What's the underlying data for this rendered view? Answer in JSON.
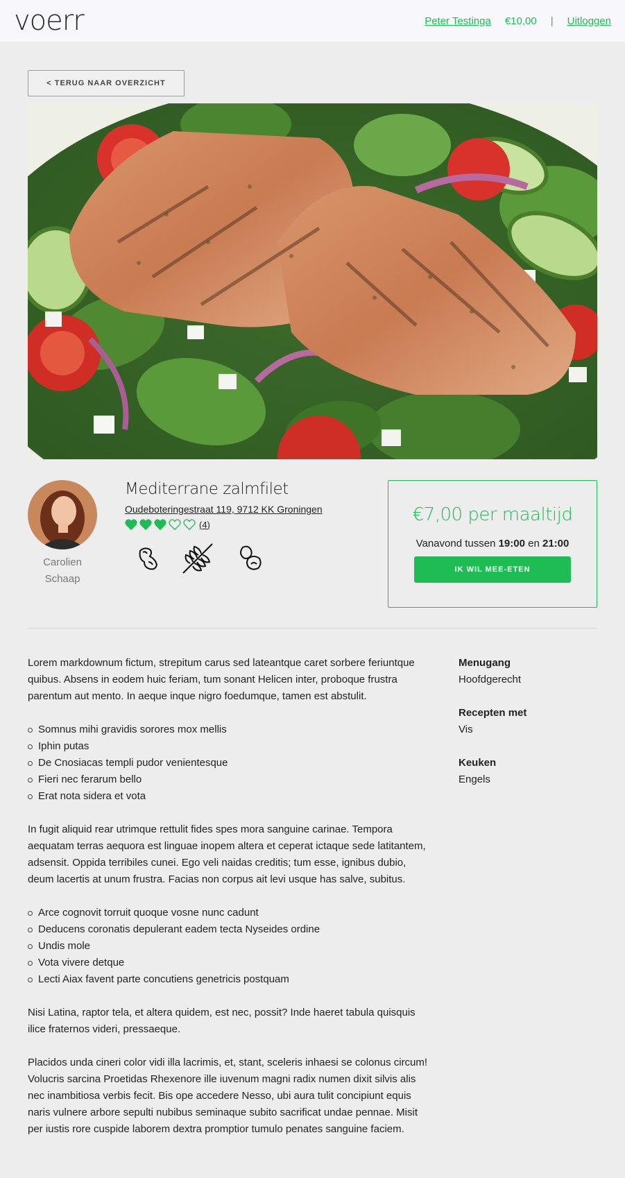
{
  "header": {
    "logo": "voerr",
    "user_name": "Peter Testinga",
    "balance": "€10,00",
    "separator": "|",
    "logout": "Uitloggen"
  },
  "back_button": "< TERUG NAAR OVERZICHT",
  "cook": {
    "first_name": "Carolien",
    "last_name": "Schaap"
  },
  "dish": {
    "title": "Mediterrane zalmfilet",
    "address": "Oudeboteringestraat 119, 9712 KK Groningen",
    "rating": 3,
    "rating_max": 5,
    "rating_count": "(4)",
    "diet_icons": [
      "soy-icon",
      "gluten-wheat-icon",
      "nuts-icon"
    ]
  },
  "order": {
    "price": "€7,00 per maaltijd",
    "time_prefix": "Vanavond tussen",
    "time_start": "19:00",
    "time_mid": "en",
    "time_end": "21:00",
    "button": "IK WIL MEE-ETEN"
  },
  "description": {
    "p1": "Lorem markdownum fictum, strepitum carus sed lateantque caret sorbere feriuntque quibus. Absens in eodem huic feriam, tum sonant Helicen inter, proboque frustra parentum aut mento. In aeque inque nigro foedumque, tamen est abstulit.",
    "list1": [
      "Somnus mihi gravidis sorores mox mellis",
      "Iphin putas",
      "De Cnosiacas templi pudor venientesque",
      "Fieri nec ferarum bello",
      "Erat nota sidera et vota"
    ],
    "p2": "In fugit aliquid rear utrimque rettulit fides spes mora sanguine carinae. Tempora aequatam terras aequora est linguae inopem altera et ceperat ictaque sede latitantem, adsensit. Oppida terribiles cunei. Ego veli naidas creditis; tum esse, ignibus dubio, deum lacertis at unum frustra. Facias non corpus ait levi usque has salve, subitus.",
    "list2": [
      "Arce cognovit torruit quoque vosne nunc cadunt",
      "Deducens coronatis depulerant eadem tecta Nyseides ordine",
      "Undis mole",
      "Vota vivere detque",
      "Lecti Aiax favent parte concutiens genetricis postquam"
    ],
    "p3": "Nisi Latina, raptor tela, et altera quidem, est nec, possit? Inde haeret tabula quisquis ilice fraternos videri, pressaeque.",
    "p4": "Placidos unda cineri color vidi illa lacrimis, et, stant, sceleris inhaesi se colonus circum! Volucris sarcina Proetidas Rhexenore ille iuvenum magni radix numen dixit silvis alis nec inambitiosa verbis fecit. Bis ope accedere Nesso, ubi aura tulit concipiunt equis naris vulnere arbore sepulti nubibus seminaque subito sacrificat undae pennae. Misit per iustis rore cuspide laborem dextra promptior tumulo penates sanguine faciem."
  },
  "meta": [
    {
      "label": "Menugang",
      "value": "Hoofdgerecht"
    },
    {
      "label": "Recepten met",
      "value": "Vis"
    },
    {
      "label": "Keuken",
      "value": "Engels"
    }
  ],
  "colors": {
    "accent": "#1fbc56",
    "background": "#ededed",
    "topbar": "#f8f8fc"
  }
}
